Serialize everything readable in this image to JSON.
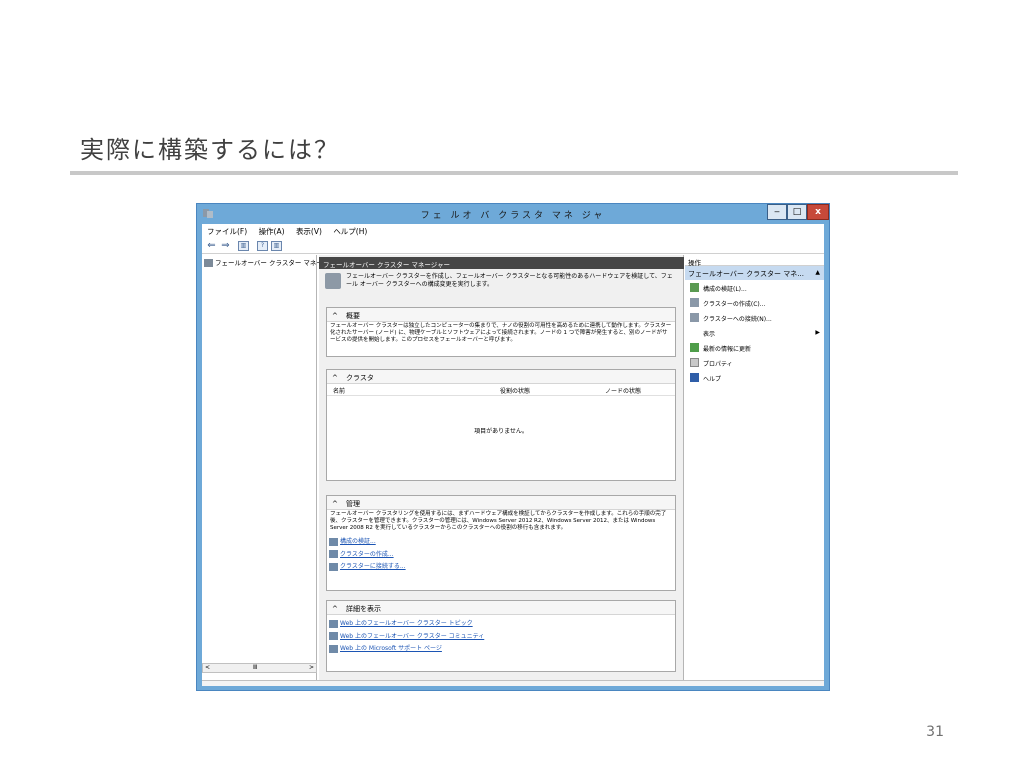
{
  "slide": {
    "title": "実際に構築するには？",
    "page_number": "31"
  },
  "window": {
    "title": "フェ ルオ バ クラスタ マネ ジャ",
    "min_label": "‒",
    "max_label": "□",
    "close_label": "x"
  },
  "menubar": {
    "items": [
      "ファイル(F)",
      "操作(A)",
      "表示(V)",
      "ヘルプ(H)"
    ]
  },
  "toolbar": {
    "icons": [
      "back-arrow-icon",
      "forward-arrow-icon",
      "show-tree-icon",
      "help-icon",
      "show-actions-icon"
    ]
  },
  "tree": {
    "root_label": "フェールオーバー クラスター マネージ",
    "scroll_left": "<",
    "scroll_thumb": "Ⅲ",
    "scroll_right": ">"
  },
  "center": {
    "header": "フェールオーバー クラスター マネージャー",
    "intro_text": "フェールオーバー クラスターを作成し、フェールオーバー クラスターとなる可能性のあるハードウェアを検証して、フェール オーバー クラスターへの構成変更を実行します。",
    "overview": {
      "caret": "^",
      "title": "概要",
      "text": "フェールオーバー クラスターは独立したコンピューターの集まりで、ナノの役割の可用性を高めるために連携して動作します。クラスター化されたサーバー (ノード) に、物理ケーブルとソフトウェアによって接続されます。ノードの 1 つで障害が発生すると、別のノードがサービスの提供を開始します。このプロセスをフェールオーバーと呼びます。"
    },
    "clusters": {
      "caret": "^",
      "title": "クラスタ",
      "col_name": "名前",
      "col_role_status": "役割の状態",
      "col_node_status": "ノードの状態",
      "empty_text": "項目がありません。"
    },
    "management": {
      "caret": "^",
      "title": "管理",
      "text": "フェールオーバー クラスタリングを使用するには、まずハードウェア構成を検証してからクラスターを作成します。これらの手順の完了後、クラスターを管理できます。クラスターの管理には、Windows Server 2012 R2、Windows Server 2012、または Windows Server 2008 R2 を実行しているクラスターからこのクラスターへの役割の移行も含まれます。",
      "links": [
        "構成の検証...",
        "クラスターの作成...",
        "クラスターに接続する..."
      ]
    },
    "details": {
      "caret": "^",
      "title": "詳細を表示",
      "links": [
        "Web 上のフェールオーバー クラスター トピック",
        "Web 上のフェールオーバー クラスター コミュニティ",
        "Web 上の Microsoft サポート ページ"
      ]
    }
  },
  "actions": {
    "header": "操作",
    "group_title": "フェールオーバー クラスター マネ...",
    "group_toggle": "▲",
    "items": [
      "構成の検証(L)...",
      "クラスターの作成(C)...",
      "クラスターへの接続(N)...",
      "表示",
      "最新の情報に更新",
      "プロパティ",
      "ヘルプ"
    ],
    "submenu_arrow": "▶"
  }
}
